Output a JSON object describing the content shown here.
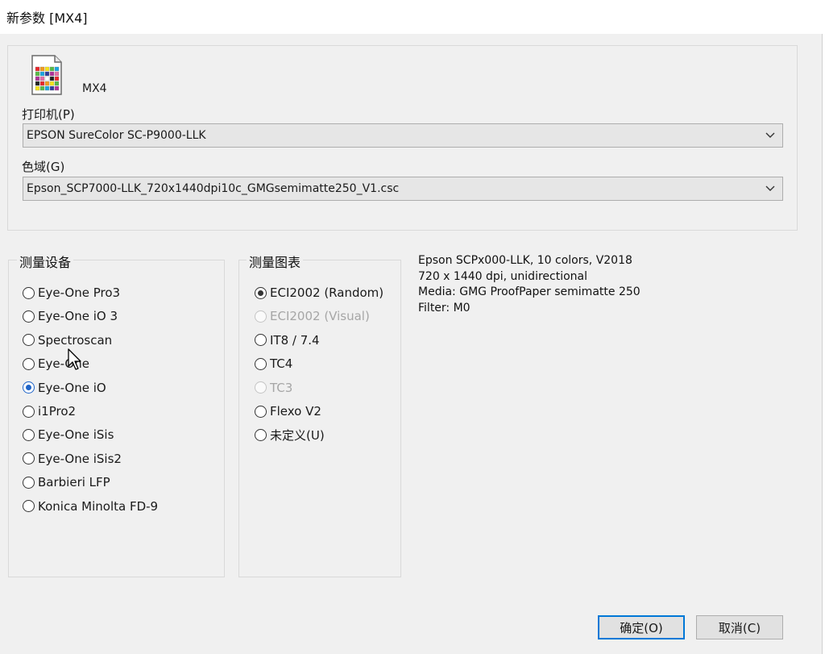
{
  "window": {
    "title": "新参数 [MX4]"
  },
  "header": {
    "app_name": "MX4",
    "icon": "color-chart-document-icon"
  },
  "printer": {
    "label": "打印机(P)",
    "value": "EPSON SureColor SC-P9000-LLK"
  },
  "gamut": {
    "label": "色域(G)",
    "value": "Epson_SCP7000-LLK_720x1440dpi10c_GMGsemimatte250_V1.csc"
  },
  "devices": {
    "title": "测量设备",
    "selected": "Eye-One iO",
    "items": [
      "Eye-One Pro3",
      "Eye-One iO 3",
      "Spectroscan",
      "Eye-One",
      "Eye-One iO",
      "i1Pro2",
      "Eye-One iSis",
      "Eye-One iSis2",
      "Barbieri LFP",
      "Konica Minolta FD-9"
    ]
  },
  "charts": {
    "title": "测量图表",
    "selected": "ECI2002 (Random)",
    "disabled": [
      "ECI2002 (Visual)",
      "TC3"
    ],
    "items": [
      "ECI2002 (Random)",
      "ECI2002 (Visual)",
      "IT8 / 7.4",
      "TC4",
      "TC3",
      "Flexo V2",
      "未定义(U)"
    ]
  },
  "info": {
    "lines": [
      "Epson SCPx000-LLK, 10 colors, V2018",
      "720 x 1440 dpi, unidirectional",
      "Media: GMG ProofPaper semimatte 250",
      "Filter: M0"
    ]
  },
  "buttons": {
    "ok": "确定(O)",
    "cancel": "取消(C)"
  },
  "colors": {
    "accent": "#0078d7",
    "radio_selected": "#1e64c8"
  }
}
